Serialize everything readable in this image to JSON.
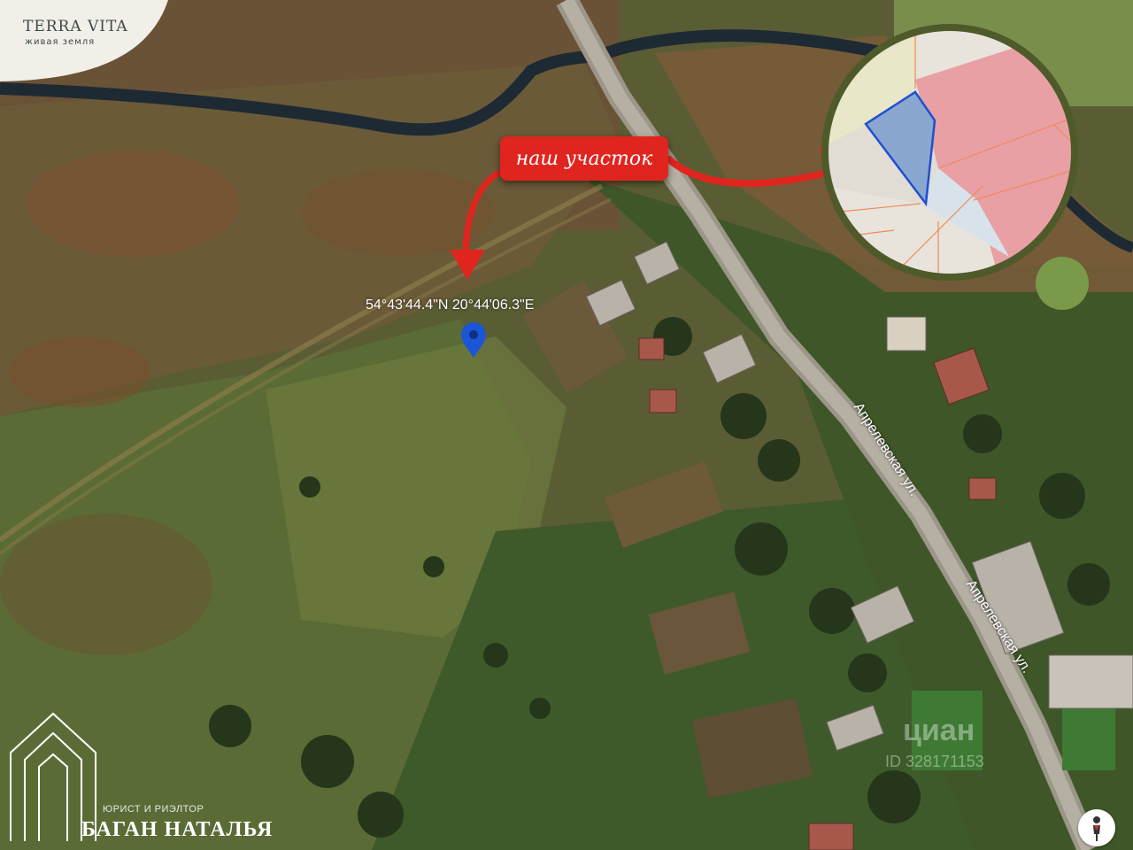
{
  "brand_top": {
    "name": "TERRA VITA",
    "tagline": "живая земля"
  },
  "callout": {
    "label": "наш участок"
  },
  "marker": {
    "coordinates": "54°43'44.4\"N 20°44'06.3\"E",
    "icon": "map-pin-icon",
    "color": "#1a56d6"
  },
  "streets": [
    "Апрелевская ул.",
    "Апрелевская ул."
  ],
  "brand_bottom": {
    "subtitle": "ЮРИСТ И РИЭЛТОР",
    "name": "БАГАН НАТАЛЬЯ",
    "icon": "house-outline-icon"
  },
  "watermark": {
    "logo": "циан",
    "id": "ID 328171153"
  },
  "controls": {
    "street_view_icon": "person-icon"
  },
  "colors": {
    "callout": "#e0251f",
    "arrow": "#e0251f",
    "plot_highlight": "#8aa8cf",
    "neighbor_plots": "#e8a0a4",
    "inset_border": "#4e5a2a"
  }
}
